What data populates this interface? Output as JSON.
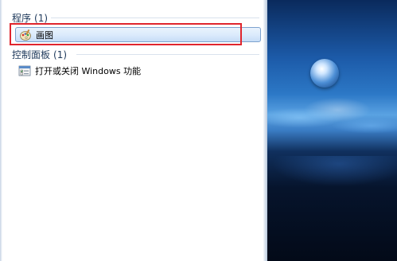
{
  "search_results": {
    "programs": {
      "label": "程序",
      "count": "(1)",
      "items": [
        {
          "label": "画图",
          "icon": "paint-icon"
        }
      ]
    },
    "control_panel": {
      "label": "控制面板",
      "count": "(1)",
      "items": [
        {
          "label": "打开或关闭 Windows 功能",
          "icon": "windows-features-icon"
        }
      ]
    }
  },
  "colors": {
    "highlight_frame": "#e0252d",
    "selection": "#c7ddf7",
    "group_header_text": "#1e395b"
  }
}
